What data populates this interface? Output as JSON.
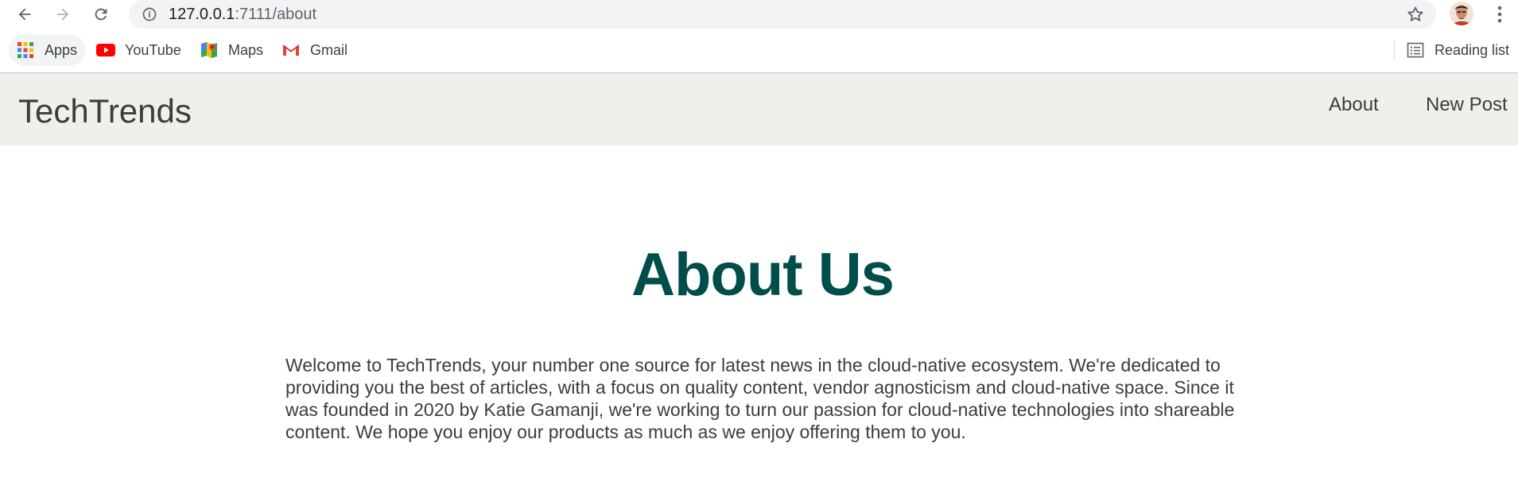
{
  "browser": {
    "url_host": "127.0.0.1",
    "url_path": ":7111/about",
    "bookmarks": [
      {
        "label": "Apps",
        "icon": "apps-grid-icon"
      },
      {
        "label": "YouTube",
        "icon": "youtube-icon"
      },
      {
        "label": "Maps",
        "icon": "maps-icon"
      },
      {
        "label": "Gmail",
        "icon": "gmail-icon"
      }
    ],
    "reading_list_label": "Reading list"
  },
  "site": {
    "brand": "TechTrends",
    "nav": {
      "about": "About",
      "new_post": "New Post"
    }
  },
  "main": {
    "title": "About Us",
    "body": "Welcome to TechTrends, your number one source for latest news in the cloud-native ecosystem. We're dedicated to providing you the best of articles, with a focus on quality content, vendor agnosticism and cloud-native space. Since it was founded in 2020 by Katie Gamanji, we're working to turn our passion for cloud-native technologies into shareable content. We hope you enjoy our products as much as we enjoy offering them to you."
  },
  "colors": {
    "nav_background": "#f0efeb",
    "title_color": "#004d4a",
    "text_color": "#3c3c3c"
  }
}
